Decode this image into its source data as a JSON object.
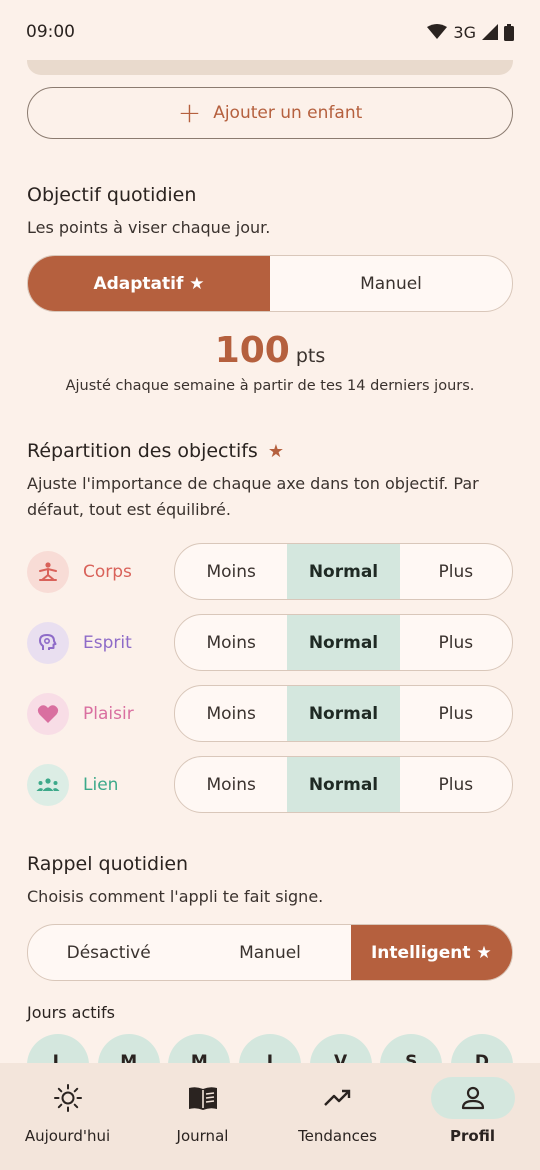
{
  "status": {
    "time": "09:00",
    "network": "3G"
  },
  "add_child": {
    "label": "Ajouter un enfant"
  },
  "daily_goal": {
    "title": "Objectif quotidien",
    "subtitle": "Les points à viser chaque jour.",
    "options": [
      "Adaptatif ★",
      "Manuel"
    ],
    "selected": "Adaptatif ★",
    "points_value": "100",
    "points_unit": "pts",
    "note": "Ajusté chaque semaine à partir de tes 14 derniers jours."
  },
  "distribution": {
    "title": "Répartition des objectifs",
    "subtitle": "Ajuste l'importance de chaque axe dans ton objectif. Par défaut, tout est équilibré.",
    "levels": [
      "Moins",
      "Normal",
      "Plus"
    ],
    "axes": [
      {
        "name": "Corps",
        "color": "#D9625A",
        "bg": "#F8DCD6",
        "selected": "Normal"
      },
      {
        "name": "Esprit",
        "color": "#8E6BC8",
        "bg": "#E9DFF0",
        "selected": "Normal"
      },
      {
        "name": "Plaisir",
        "color": "#D96FA0",
        "bg": "#F8DDE6",
        "selected": "Normal"
      },
      {
        "name": "Lien",
        "color": "#3DA98A",
        "bg": "#DCEDE5",
        "selected": "Normal"
      }
    ]
  },
  "reminder": {
    "title": "Rappel quotidien",
    "subtitle": "Choisis comment l'appli te fait signe.",
    "options": [
      "Désactivé",
      "Manuel",
      "Intelligent ★"
    ],
    "selected": "Intelligent ★"
  },
  "active_days": {
    "title": "Jours actifs",
    "days": [
      "L",
      "M",
      "M",
      "J",
      "V",
      "S",
      "D"
    ]
  },
  "nav": {
    "items": [
      "Aujourd'hui",
      "Journal",
      "Tendances",
      "Profil"
    ],
    "active": "Profil"
  },
  "colors": {
    "accent": "#B5603E",
    "mint": "#D4E7DE",
    "background": "#FCF1EA"
  }
}
